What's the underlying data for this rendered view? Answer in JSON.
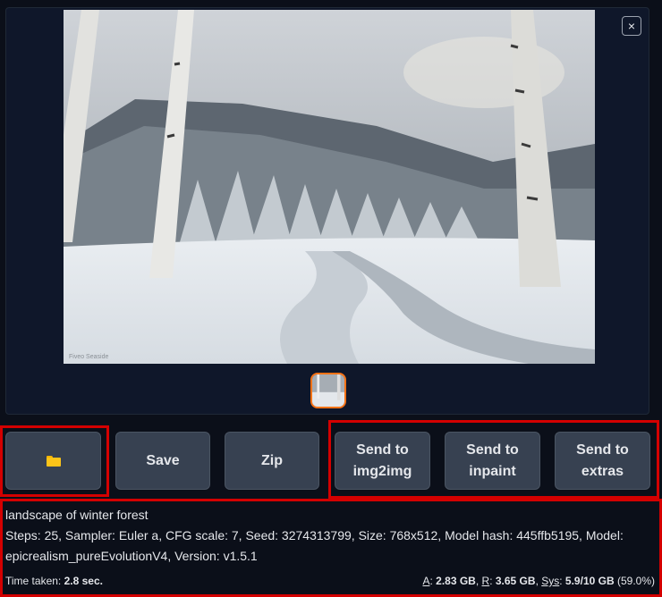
{
  "gallery": {
    "close_label": "×",
    "image_watermark": "Fiveo Seaside"
  },
  "buttons": {
    "open_folder": {
      "icon": "folder-icon",
      "color": "#fcc419"
    },
    "save": "Save",
    "zip": "Zip",
    "send_img2img": [
      "Send to",
      "img2img"
    ],
    "send_inpaint": [
      "Send to",
      "inpaint"
    ],
    "send_extras": [
      "Send to",
      "extras"
    ]
  },
  "info": {
    "prompt": "landscape of winter forest",
    "params": "Steps: 25, Sampler: Euler a, CFG scale: 7, Seed: 3274313799, Size: 768x512, Model hash: 445ffb5195, Model: epicrealism_pureEvolutionV4, Version: v1.5.1"
  },
  "status": {
    "time_label": "Time taken:",
    "time_value": "2.8 sec.",
    "a_label": "A",
    "a_value": "2.83 GB",
    "r_label": "R",
    "r_value": "3.65 GB",
    "sys_label": "Sys",
    "sys_value": "5.9/10 GB",
    "sys_pct": "(59.0%)"
  },
  "colors": {
    "background": "#0b0f19",
    "button": "#374151",
    "highlight": "#d40000",
    "thumb_border": "#f97316"
  }
}
